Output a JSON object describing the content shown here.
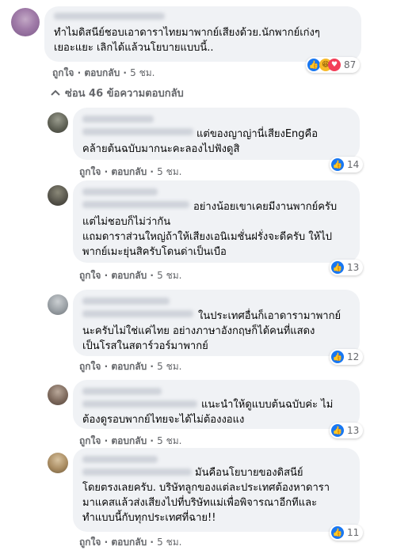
{
  "main_comment": {
    "text": "ทำไมดิสนีย์ชอบเอาดาราไทยมาพากย์เสียงด้วย.นักพากย์เก่งๆ\nเยอะแยะ เลิกได้แล้วนโยบายแบบนี้..",
    "like_label": "ถูกใจ",
    "reply_label": "ตอบกลับ",
    "time": "5 ชม.",
    "reaction_count": "87"
  },
  "replies_toggle": {
    "label": "ซ่อน 46 ข้อความตอบกลับ"
  },
  "replies": [
    {
      "text": "แต่ของญาญ่านี่เสียงEngคือ\nคล้ายต้นฉบับมากนะคะลองไปฟังดูสิ",
      "like_label": "ถูกใจ",
      "reply_label": "ตอบกลับ",
      "time": "5 ชม.",
      "reaction_count": "14"
    },
    {
      "text": "อย่างน้อยเขาเคยมีงานพากย์ครับ\nแต่ไม่ชอบก็ไม่ว่ากัน\nแถมดาราส่วนใหญ่ถ้าให้เสียงเอนิเมชั่นฝรั่งจะดีครับ ให้ไป\nพากย์เมะยุ่นสิครับโดนด่าเป็นเบือ",
      "like_label": "ถูกใจ",
      "reply_label": "ตอบกลับ",
      "time": "5 ชม.",
      "reaction_count": "13"
    },
    {
      "text": "ในประเทศอื่นก็เอาดารามาพากย์\nนะครับไม่ใช่แค่ไทย อย่างภาษาอังกฤษก็ได้คนที่แสดง\nเป็นโรสในสตาร์วอร์มาพากย์",
      "like_label": "ถูกใจ",
      "reply_label": "ตอบกลับ",
      "time": "5 ชม.",
      "reaction_count": "12"
    },
    {
      "text": "แนะนำให้ดูแบบต้นฉบับค่ะ ไม่\nต้องดูรอบพากย์ไทยจะได้ไม่ต้องงอแง",
      "like_label": "ถูกใจ",
      "reply_label": "ตอบกลับ",
      "time": "5 ชม.",
      "reaction_count": "13"
    },
    {
      "text": "มันคือนโยบายของดิสนีย์\nโดยตรงเลยครับ. บริษัทลูกของแต่ละประเทศต้องหาดารา\nมาแคสแล้วส่งเสียงไปที่บริษัทแม่เพื่อพิจารณาอีกทีและ\nทำแบบนี้กับทุกประเทศที่ฉาย!!",
      "like_label": "ถูกใจ",
      "reply_label": "ตอบกลับ",
      "time": "5 ชม.",
      "reaction_count": "11"
    }
  ],
  "colors": {
    "bubble": "#f0f2f5",
    "meta": "#65676b",
    "like": "#1877f2",
    "haha": "#f7b928",
    "love": "#f33e58"
  },
  "icons": [
    "like-icon",
    "haha-icon",
    "love-icon",
    "chevron-up-icon"
  ]
}
